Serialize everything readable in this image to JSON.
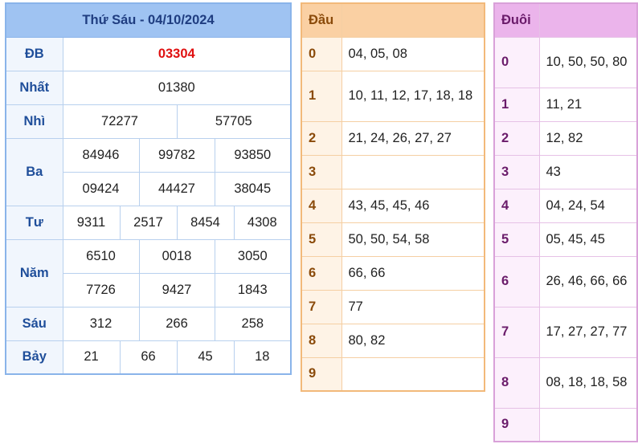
{
  "results": {
    "title": "Thứ Sáu - 04/10/2024",
    "rows": [
      {
        "label": "ĐB",
        "values": [
          "03304"
        ]
      },
      {
        "label": "Nhất",
        "values": [
          "01380"
        ]
      },
      {
        "label": "Nhì",
        "values": [
          "72277",
          "57705"
        ]
      },
      {
        "label": "Ba",
        "values": [
          "84946",
          "99782",
          "93850",
          "09424",
          "44427",
          "38045"
        ]
      },
      {
        "label": "Tư",
        "values": [
          "9311",
          "2517",
          "8454",
          "4308"
        ]
      },
      {
        "label": "Năm",
        "values": [
          "6510",
          "0018",
          "3050",
          "7726",
          "9427",
          "1843"
        ]
      },
      {
        "label": "Sáu",
        "values": [
          "312",
          "266",
          "258"
        ]
      },
      {
        "label": "Bảy",
        "values": [
          "21",
          "66",
          "45",
          "18"
        ]
      }
    ]
  },
  "head": {
    "title": "Đầu",
    "rows": [
      {
        "digit": "0",
        "values": "04, 05, 08"
      },
      {
        "digit": "1",
        "values": "10, 11, 12, 17, 18, 18"
      },
      {
        "digit": "2",
        "values": "21, 24, 26, 27, 27"
      },
      {
        "digit": "3",
        "values": ""
      },
      {
        "digit": "4",
        "values": "43, 45, 45, 46"
      },
      {
        "digit": "5",
        "values": "50, 50, 54, 58"
      },
      {
        "digit": "6",
        "values": "66, 66"
      },
      {
        "digit": "7",
        "values": "77"
      },
      {
        "digit": "8",
        "values": "80, 82"
      },
      {
        "digit": "9",
        "values": ""
      }
    ]
  },
  "tail": {
    "title": "Đuôi",
    "rows": [
      {
        "digit": "0",
        "values": "10, 50, 50, 80"
      },
      {
        "digit": "1",
        "values": "11, 21"
      },
      {
        "digit": "2",
        "values": "12, 82"
      },
      {
        "digit": "3",
        "values": "43"
      },
      {
        "digit": "4",
        "values": "04, 24, 54"
      },
      {
        "digit": "5",
        "values": "05, 45, 45"
      },
      {
        "digit": "6",
        "values": "26, 46, 66, 66"
      },
      {
        "digit": "7",
        "values": "17, 27, 27, 77"
      },
      {
        "digit": "8",
        "values": "08, 18, 18, 58"
      },
      {
        "digit": "9",
        "values": ""
      }
    ]
  }
}
